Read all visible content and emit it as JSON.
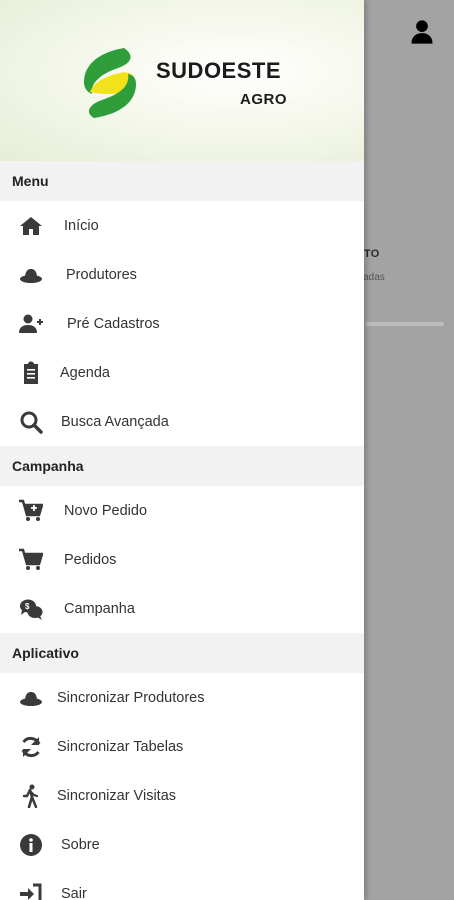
{
  "brand": {
    "name": "SUDOESTE",
    "sub": "AGRO",
    "colors": {
      "green": "#2f9e3a",
      "yellow": "#f2e21a"
    }
  },
  "sections": {
    "menu": {
      "title": "Menu",
      "items": [
        {
          "label": "Início",
          "icon": "home-icon"
        },
        {
          "label": "Produtores",
          "icon": "hat-icon"
        },
        {
          "label": "Pré Cadastros",
          "icon": "user-plus-icon"
        },
        {
          "label": "Agenda",
          "icon": "clipboard-icon"
        },
        {
          "label": "Busca Avançada",
          "icon": "search-icon"
        }
      ]
    },
    "campanha": {
      "title": "Campanha",
      "items": [
        {
          "label": "Novo Pedido",
          "icon": "cart-plus-icon"
        },
        {
          "label": "Pedidos",
          "icon": "cart-icon"
        },
        {
          "label": "Campanha",
          "icon": "money-chat-icon"
        }
      ]
    },
    "aplicativo": {
      "title": "Aplicativo",
      "items": [
        {
          "label": "Sincronizar Produtores",
          "icon": "hat-icon"
        },
        {
          "label": "Sincronizar Tabelas",
          "icon": "sync-icon"
        },
        {
          "label": "Sincronizar Visitas",
          "icon": "walking-icon"
        },
        {
          "label": "Sobre",
          "icon": "info-icon"
        },
        {
          "label": "Sair",
          "icon": "sign-in-icon"
        }
      ]
    }
  },
  "background": {
    "card_title": "ENTO",
    "card_subtitle": "ndadas"
  }
}
